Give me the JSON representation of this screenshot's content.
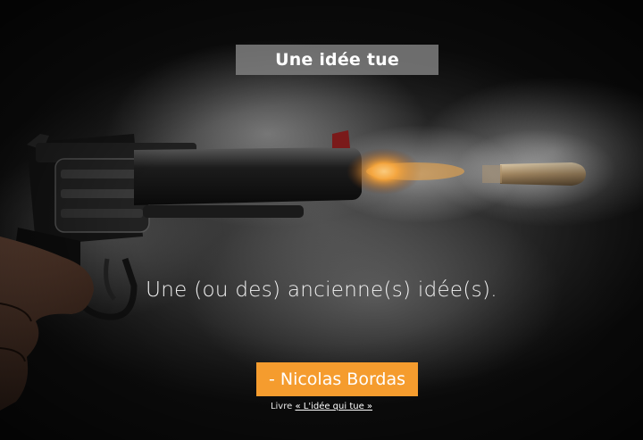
{
  "title": "Une idée tue",
  "quote": "Une (ou des) ancienne(s) idée(s).",
  "author": "- Nicolas Bordas",
  "source": {
    "prefix": "Livre",
    "link_text": "« L'idée qui tue »"
  }
}
